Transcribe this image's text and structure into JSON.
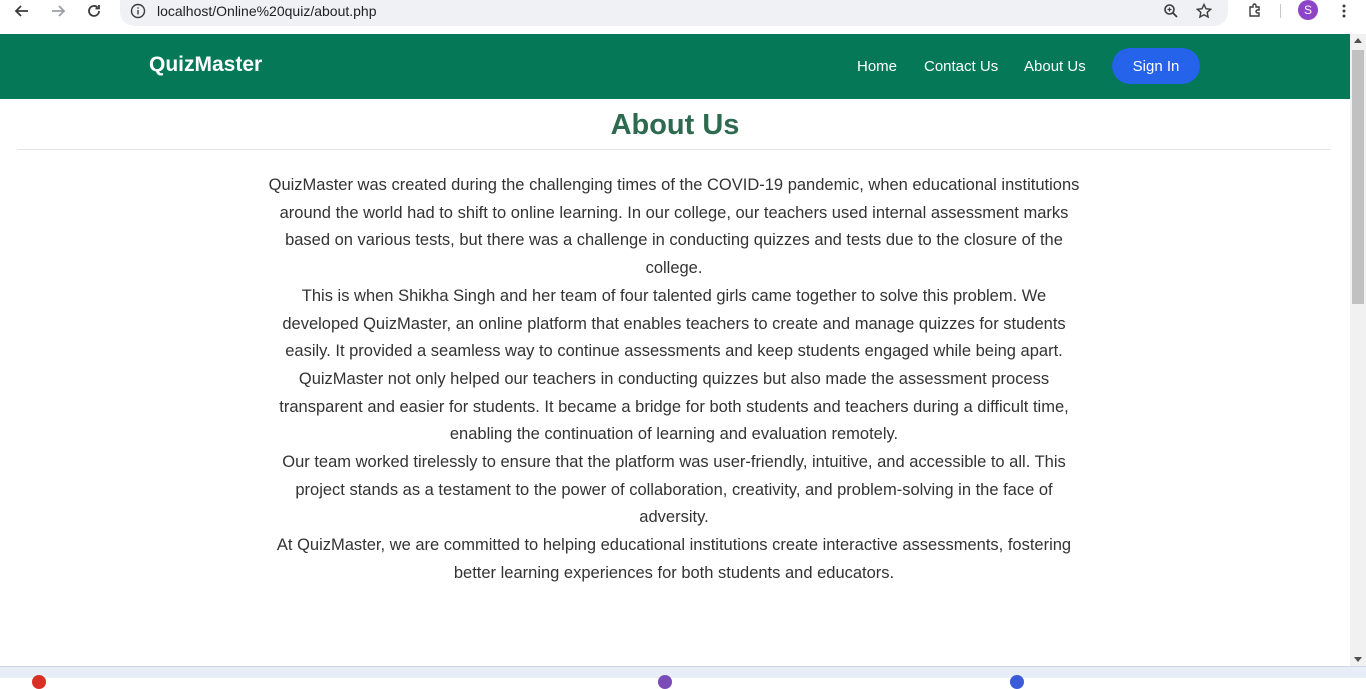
{
  "browser": {
    "url": "localhost/Online%20quiz/about.php",
    "profile_initial": "S"
  },
  "navbar": {
    "brand": "QuizMaster",
    "links": [
      "Home",
      "Contact Us",
      "About Us"
    ],
    "signin_label": "Sign In"
  },
  "page": {
    "title": "About Us",
    "paragraphs": [
      "QuizMaster was created during the challenging times of the COVID-19 pandemic, when educational institutions around the world had to shift to online learning. In our college, our teachers used internal assessment marks based on various tests, but there was a challenge in conducting quizzes and tests due to the closure of the college.",
      "This is when Shikha Singh and her team of four talented girls came together to solve this problem. We developed QuizMaster, an online platform that enables teachers to create and manage quizzes for students easily. It provided a seamless way to continue assessments and keep students engaged while being apart.",
      "QuizMaster not only helped our teachers in conducting quizzes but also made the assessment process transparent and easier for students. It became a bridge for both students and teachers during a difficult time, enabling the continuation of learning and evaluation remotely.",
      "Our team worked tirelessly to ensure that the platform was user-friendly, intuitive, and accessible to all. This project stands as a testament to the power of collaboration, creativity, and problem-solving in the face of adversity.",
      "At QuizMaster, we are committed to helping educational institutions create interactive assessments, fostering better learning experiences for both students and educators."
    ]
  },
  "colors": {
    "navbar": "#047857",
    "signin": "#2563eb",
    "title": "#2d6a4f"
  }
}
